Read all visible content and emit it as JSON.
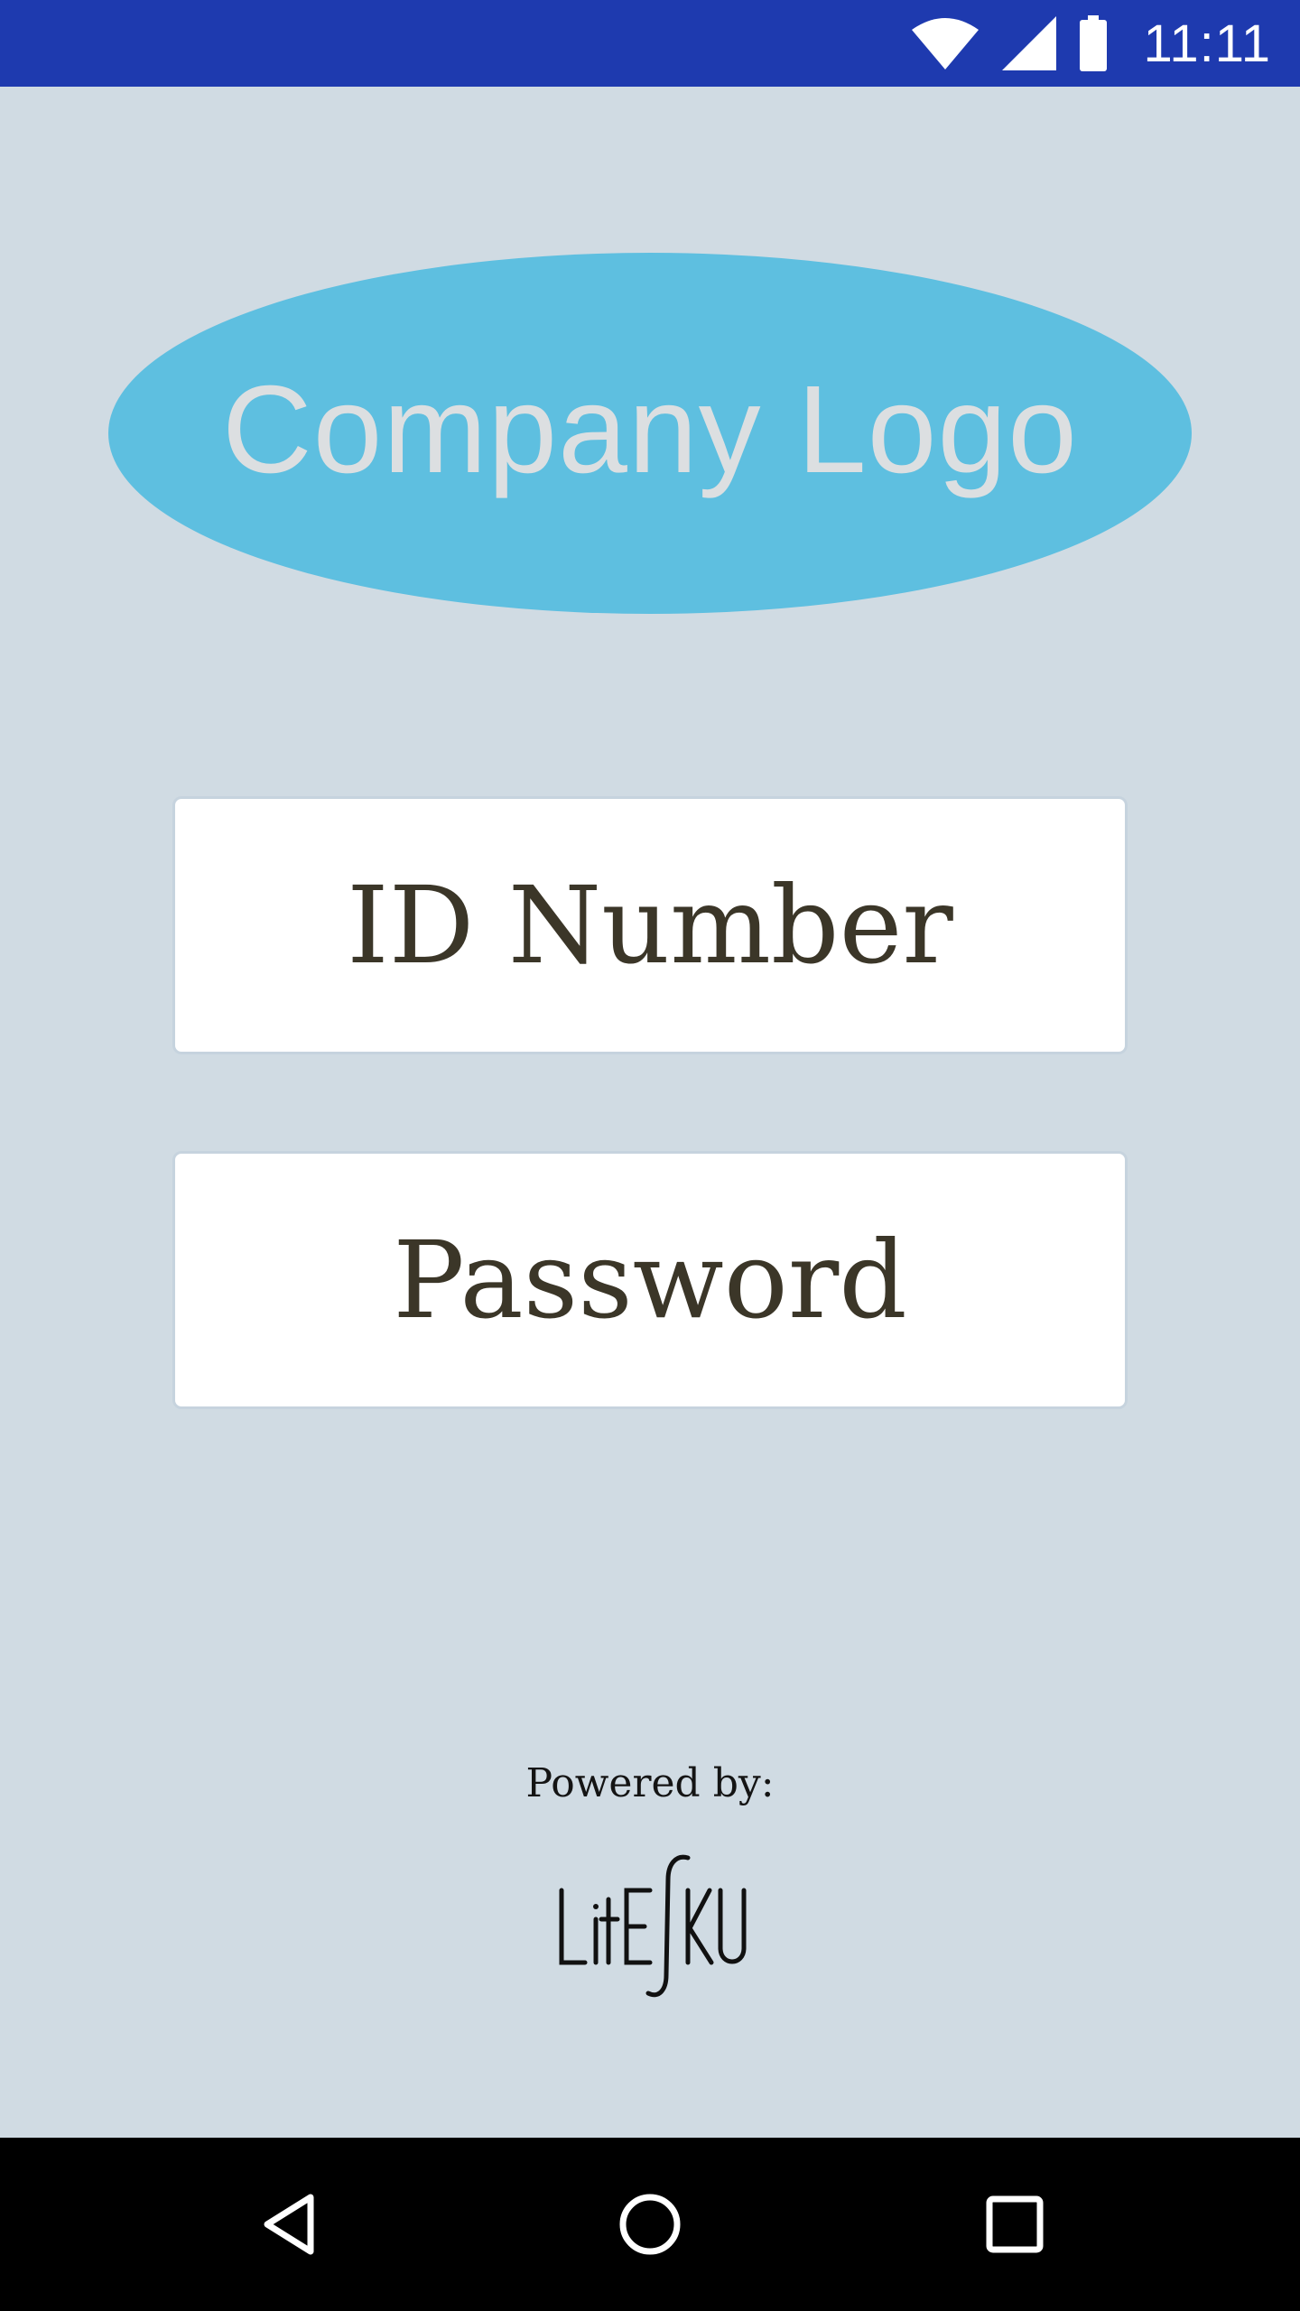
{
  "status_bar": {
    "time": "11:11",
    "icons": [
      "wifi-icon",
      "cell-signal-icon",
      "battery-icon"
    ],
    "background": "#1e3aaf"
  },
  "logo": {
    "text": "Company Logo",
    "color": "#5ebfe0"
  },
  "form": {
    "id_placeholder": "ID Number",
    "password_placeholder": "Password"
  },
  "footer": {
    "powered_by": "Powered by:",
    "brand": "LitESKU"
  },
  "nav_bar": {
    "icons": [
      "back-icon",
      "home-icon",
      "recents-icon"
    ]
  }
}
